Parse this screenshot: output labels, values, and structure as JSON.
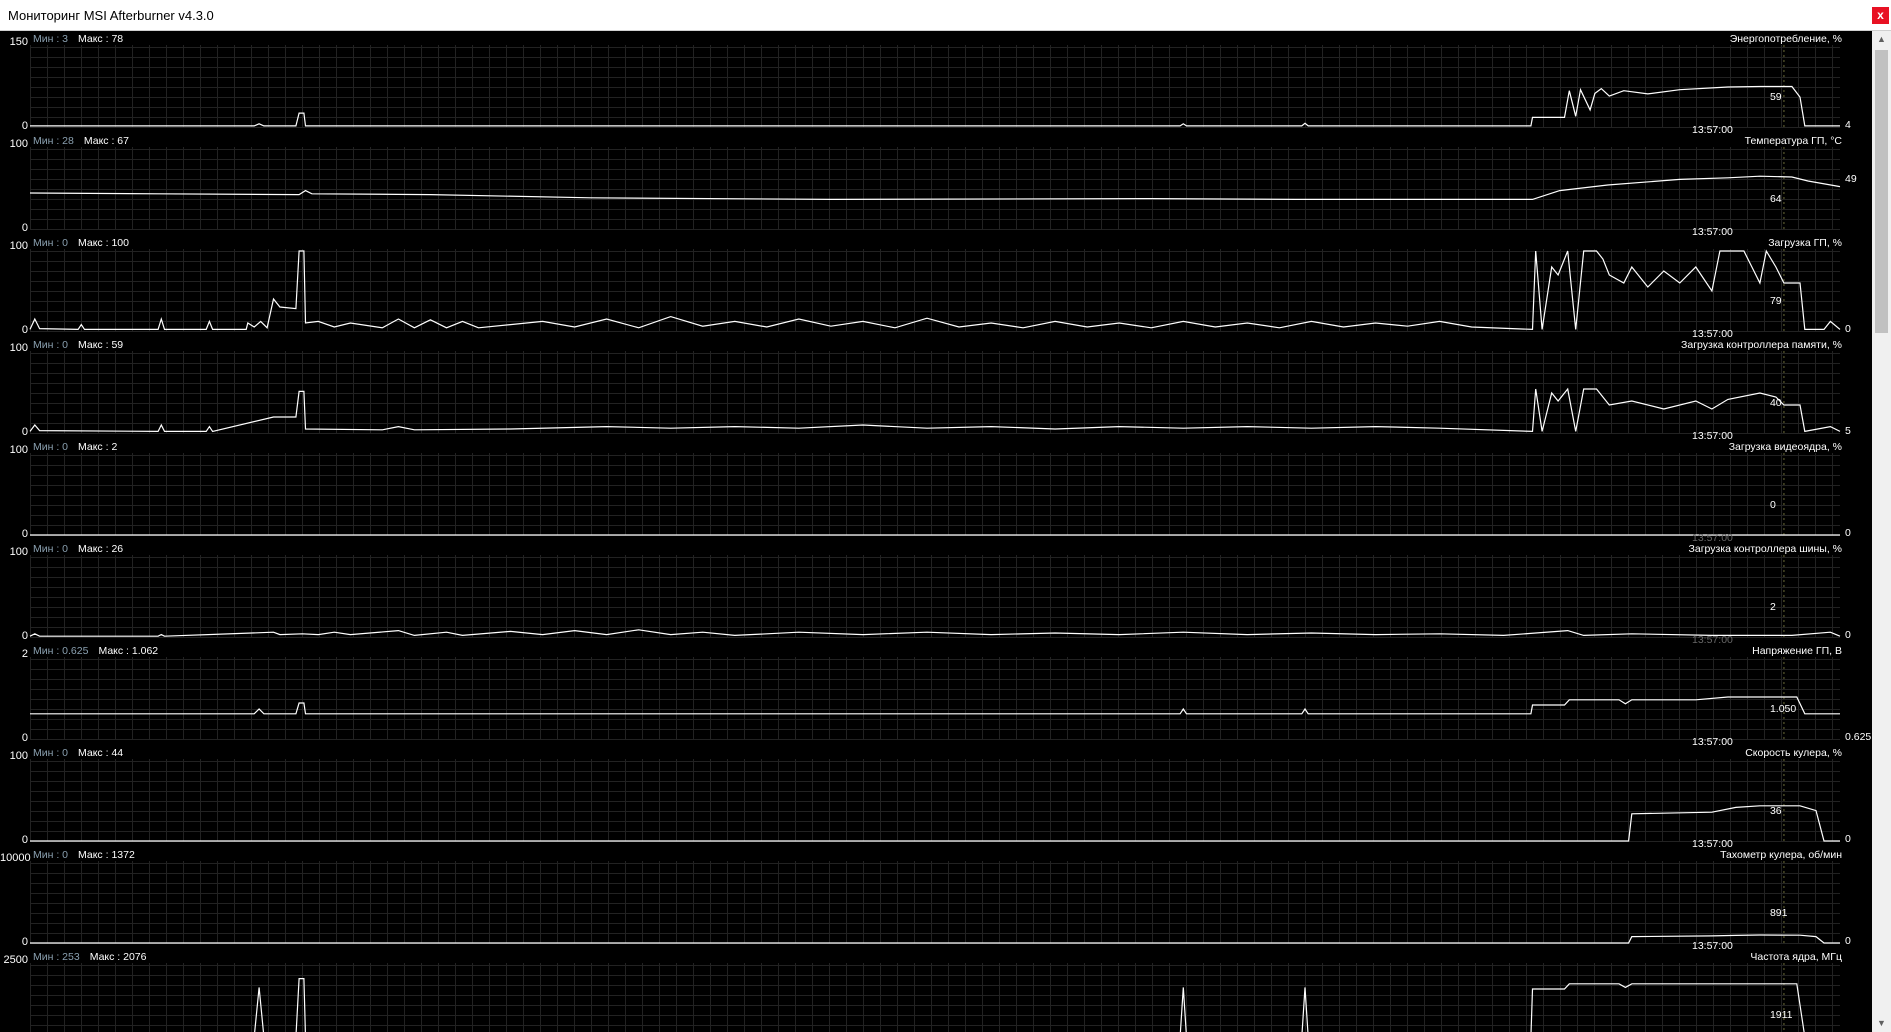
{
  "window": {
    "title": "Мониторинг MSI Afterburner v4.3.0",
    "close_label": "x"
  },
  "labels": {
    "min": "Мин : ",
    "max": "Макс : "
  },
  "colors": {
    "background": "#000000",
    "grid": "#222222",
    "line": "#ffffff",
    "close": "#e81123"
  },
  "scrollbar": {
    "position_fraction": 0.0,
    "visible_fraction": 0.28
  },
  "graphs": [
    {
      "name": "Энергопотребление, %",
      "ymax": "150",
      "ymin": "0",
      "min": "3",
      "max": "78",
      "current": "59",
      "right_value": "4",
      "timestamp": "13:57:00",
      "series": [
        [
          0,
          2
        ],
        [
          14,
          2
        ],
        [
          14.3,
          6
        ],
        [
          14.6,
          2
        ],
        [
          16.6,
          2
        ],
        [
          16.8,
          26
        ],
        [
          17.1,
          26
        ],
        [
          17.2,
          2
        ],
        [
          71.8,
          2
        ],
        [
          72,
          6
        ],
        [
          72.2,
          2
        ],
        [
          79.4,
          2
        ],
        [
          79.6,
          7
        ],
        [
          79.8,
          2
        ],
        [
          93.7,
          2
        ],
        [
          93.8,
          18
        ],
        [
          95.8,
          18
        ],
        [
          96.1,
          68
        ],
        [
          96.5,
          20
        ],
        [
          96.8,
          70
        ],
        [
          97.4,
          32
        ],
        [
          97.7,
          63
        ],
        [
          98.1,
          72
        ],
        [
          98.6,
          58
        ],
        [
          99.5,
          68
        ],
        [
          101,
          62
        ],
        [
          103,
          70
        ],
        [
          106,
          75
        ],
        [
          108,
          76
        ],
        [
          110,
          76
        ],
        [
          110.5,
          56
        ],
        [
          110.8,
          2
        ],
        [
          113,
          2
        ]
      ]
    },
    {
      "name": "Температура ГП, °C",
      "ymax": "100",
      "ymin": "0",
      "min": "28",
      "max": "67",
      "current": "64",
      "right_value": "49",
      "timestamp": "13:57:00",
      "series": [
        [
          0,
          45
        ],
        [
          8,
          44
        ],
        [
          16.8,
          43
        ],
        [
          17.2,
          48
        ],
        [
          17.6,
          44
        ],
        [
          25,
          43
        ],
        [
          35,
          39
        ],
        [
          50,
          37
        ],
        [
          70,
          38
        ],
        [
          79,
          37
        ],
        [
          93.8,
          37
        ],
        [
          95.5,
          48
        ],
        [
          98.5,
          55
        ],
        [
          103,
          62
        ],
        [
          106,
          64
        ],
        [
          108,
          66
        ],
        [
          110,
          65
        ],
        [
          111,
          60
        ],
        [
          113,
          53
        ]
      ]
    },
    {
      "name": "Загрузка ГП, %",
      "ymax": "100",
      "ymin": "0",
      "min": "0",
      "max": "100",
      "current": "79",
      "right_value": "0",
      "timestamp": "13:57:00",
      "series": [
        [
          0,
          2
        ],
        [
          0.3,
          15
        ],
        [
          0.6,
          3
        ],
        [
          3,
          2
        ],
        [
          3.2,
          8
        ],
        [
          3.4,
          2
        ],
        [
          8,
          2
        ],
        [
          8.2,
          15
        ],
        [
          8.4,
          2
        ],
        [
          11,
          2
        ],
        [
          11.2,
          12
        ],
        [
          11.4,
          2
        ],
        [
          13.5,
          2
        ],
        [
          13.6,
          10
        ],
        [
          14,
          5
        ],
        [
          14.4,
          12
        ],
        [
          14.8,
          4
        ],
        [
          15.2,
          40
        ],
        [
          15.6,
          30
        ],
        [
          16.6,
          28
        ],
        [
          16.8,
          100
        ],
        [
          17.1,
          100
        ],
        [
          17.2,
          10
        ],
        [
          18,
          12
        ],
        [
          19,
          5
        ],
        [
          20,
          10
        ],
        [
          22,
          4
        ],
        [
          23,
          15
        ],
        [
          24,
          4
        ],
        [
          25,
          14
        ],
        [
          26,
          4
        ],
        [
          27,
          12
        ],
        [
          28,
          4
        ],
        [
          30,
          8
        ],
        [
          32,
          12
        ],
        [
          34,
          5
        ],
        [
          36,
          15
        ],
        [
          38,
          4
        ],
        [
          40,
          18
        ],
        [
          42,
          6
        ],
        [
          44,
          12
        ],
        [
          46,
          5
        ],
        [
          48,
          15
        ],
        [
          50,
          6
        ],
        [
          52,
          12
        ],
        [
          54,
          4
        ],
        [
          56,
          16
        ],
        [
          58,
          5
        ],
        [
          60,
          10
        ],
        [
          62,
          4
        ],
        [
          64,
          12
        ],
        [
          66,
          5
        ],
        [
          68,
          10
        ],
        [
          70,
          4
        ],
        [
          72,
          12
        ],
        [
          74,
          5
        ],
        [
          76,
          10
        ],
        [
          78,
          4
        ],
        [
          80,
          12
        ],
        [
          82,
          5
        ],
        [
          84,
          10
        ],
        [
          86,
          6
        ],
        [
          88,
          12
        ],
        [
          90,
          5
        ],
        [
          93.8,
          2
        ],
        [
          94,
          100
        ],
        [
          94.4,
          2
        ],
        [
          95,
          80
        ],
        [
          95.4,
          70
        ],
        [
          96,
          100
        ],
        [
          96.5,
          2
        ],
        [
          97,
          100
        ],
        [
          97.8,
          100
        ],
        [
          98.2,
          90
        ],
        [
          98.6,
          70
        ],
        [
          99.5,
          60
        ],
        [
          100,
          80
        ],
        [
          101,
          55
        ],
        [
          102,
          75
        ],
        [
          103,
          60
        ],
        [
          104,
          80
        ],
        [
          105,
          50
        ],
        [
          105.5,
          100
        ],
        [
          107,
          100
        ],
        [
          107.5,
          80
        ],
        [
          108,
          60
        ],
        [
          108.4,
          100
        ],
        [
          109,
          80
        ],
        [
          109.5,
          60
        ],
        [
          110.5,
          60
        ],
        [
          110.8,
          2
        ],
        [
          112,
          2
        ],
        [
          112.4,
          12
        ],
        [
          113,
          2
        ]
      ]
    },
    {
      "name": "Загрузка контроллера памяти, %",
      "ymax": "100",
      "ymin": "0",
      "min": "0",
      "max": "59",
      "current": "40",
      "right_value": "5",
      "timestamp": "13:57:00",
      "series": [
        [
          0,
          2
        ],
        [
          0.3,
          10
        ],
        [
          0.6,
          3
        ],
        [
          8,
          2
        ],
        [
          8.2,
          10
        ],
        [
          8.4,
          2
        ],
        [
          11,
          2
        ],
        [
          11.2,
          8
        ],
        [
          11.4,
          2
        ],
        [
          15.2,
          20
        ],
        [
          16.6,
          20
        ],
        [
          16.8,
          52
        ],
        [
          17.1,
          52
        ],
        [
          17.2,
          5
        ],
        [
          22,
          4
        ],
        [
          23,
          8
        ],
        [
          24,
          4
        ],
        [
          30,
          5
        ],
        [
          36,
          8
        ],
        [
          40,
          6
        ],
        [
          44,
          8
        ],
        [
          48,
          6
        ],
        [
          52,
          10
        ],
        [
          56,
          6
        ],
        [
          60,
          8
        ],
        [
          64,
          5
        ],
        [
          68,
          8
        ],
        [
          72,
          6
        ],
        [
          76,
          8
        ],
        [
          80,
          6
        ],
        [
          84,
          8
        ],
        [
          88,
          6
        ],
        [
          93.8,
          2
        ],
        [
          94,
          55
        ],
        [
          94.4,
          2
        ],
        [
          95,
          50
        ],
        [
          95.4,
          40
        ],
        [
          96,
          55
        ],
        [
          96.5,
          2
        ],
        [
          97,
          55
        ],
        [
          97.8,
          55
        ],
        [
          98.6,
          35
        ],
        [
          100,
          40
        ],
        [
          102,
          30
        ],
        [
          104,
          40
        ],
        [
          105,
          30
        ],
        [
          106,
          42
        ],
        [
          108,
          50
        ],
        [
          109,
          45
        ],
        [
          109.5,
          35
        ],
        [
          110.5,
          35
        ],
        [
          110.8,
          2
        ],
        [
          112.4,
          8
        ],
        [
          113,
          2
        ]
      ]
    },
    {
      "name": "Загрузка видеоядра, %",
      "ymax": "100",
      "ymin": "0",
      "min": "0",
      "max": "2",
      "current": "0",
      "right_value": "0",
      "timestamp": "13:57:00",
      "series": [
        [
          0,
          0
        ],
        [
          113,
          0
        ]
      ]
    },
    {
      "name": "Загрузка контроллера шины, %",
      "ymax": "100",
      "ymin": "0",
      "min": "0",
      "max": "26",
      "current": "2",
      "right_value": "0",
      "timestamp": "13:57:00",
      "series": [
        [
          0,
          1
        ],
        [
          0.3,
          4
        ],
        [
          0.6,
          1
        ],
        [
          8,
          1
        ],
        [
          8.2,
          3
        ],
        [
          8.4,
          1
        ],
        [
          15.2,
          6
        ],
        [
          15.6,
          3
        ],
        [
          17,
          4
        ],
        [
          18,
          3
        ],
        [
          19,
          6
        ],
        [
          20,
          3
        ],
        [
          23,
          8
        ],
        [
          24,
          2
        ],
        [
          26,
          6
        ],
        [
          27,
          2
        ],
        [
          30,
          7
        ],
        [
          32,
          3
        ],
        [
          34,
          8
        ],
        [
          36,
          3
        ],
        [
          38,
          9
        ],
        [
          40,
          3
        ],
        [
          42,
          6
        ],
        [
          44,
          2
        ],
        [
          48,
          6
        ],
        [
          52,
          3
        ],
        [
          56,
          6
        ],
        [
          60,
          3
        ],
        [
          64,
          5
        ],
        [
          68,
          3
        ],
        [
          72,
          6
        ],
        [
          76,
          3
        ],
        [
          80,
          5
        ],
        [
          84,
          3
        ],
        [
          88,
          4
        ],
        [
          92,
          2
        ],
        [
          96,
          8
        ],
        [
          97,
          2
        ],
        [
          100,
          4
        ],
        [
          105,
          2
        ],
        [
          110,
          2
        ],
        [
          112.4,
          6
        ],
        [
          113,
          1
        ]
      ]
    },
    {
      "name": "Напряжение ГП, В",
      "ymax": "2",
      "ymin": "0",
      "min": "0.625",
      "max": "1.062",
      "current": "1.050",
      "right_value": "0.625",
      "timestamp": "13:57:00",
      "series": [
        [
          0,
          0.63
        ],
        [
          14,
          0.63
        ],
        [
          14.3,
          0.75
        ],
        [
          14.6,
          0.63
        ],
        [
          16.6,
          0.63
        ],
        [
          16.8,
          0.9
        ],
        [
          17.1,
          0.9
        ],
        [
          17.2,
          0.63
        ],
        [
          71.8,
          0.63
        ],
        [
          72,
          0.75
        ],
        [
          72.2,
          0.63
        ],
        [
          79.4,
          0.63
        ],
        [
          79.6,
          0.75
        ],
        [
          79.8,
          0.63
        ],
        [
          93.7,
          0.63
        ],
        [
          93.8,
          0.85
        ],
        [
          95.8,
          0.85
        ],
        [
          96.1,
          0.98
        ],
        [
          99.2,
          0.98
        ],
        [
          99.6,
          0.88
        ],
        [
          100,
          0.98
        ],
        [
          104,
          0.98
        ],
        [
          106,
          1.05
        ],
        [
          110.3,
          1.05
        ],
        [
          110.8,
          0.63
        ],
        [
          113,
          0.63
        ]
      ]
    },
    {
      "name": "Скорость кулера, %",
      "ymax": "100",
      "ymin": "0",
      "min": "0",
      "max": "44",
      "current": "36",
      "right_value": "0",
      "timestamp": "13:57:00",
      "series": [
        [
          0,
          0
        ],
        [
          99.8,
          0
        ],
        [
          100,
          34
        ],
        [
          105,
          36
        ],
        [
          106.5,
          42
        ],
        [
          108,
          44
        ],
        [
          110.5,
          44
        ],
        [
          111.5,
          38
        ],
        [
          112,
          0
        ],
        [
          113,
          0
        ]
      ]
    },
    {
      "name": "Тахометр кулера, об/мин",
      "ymax": "10000",
      "ymin": "0",
      "min": "0",
      "max": "1372",
      "current": "891",
      "right_value": "0",
      "timestamp": "13:57:00",
      "series": [
        [
          0,
          0
        ],
        [
          99.8,
          0
        ],
        [
          100,
          800
        ],
        [
          105,
          891
        ],
        [
          106.5,
          950
        ],
        [
          108,
          1000
        ],
        [
          110.5,
          980
        ],
        [
          111.5,
          800
        ],
        [
          112,
          0
        ],
        [
          113,
          0
        ]
      ]
    },
    {
      "name": "Частота ядра, МГц",
      "ymax": "2500",
      "ymin": "0",
      "min": "253",
      "max": "2076",
      "current": "1911",
      "right_value": "",
      "timestamp": "",
      "series": [
        [
          0,
          253
        ],
        [
          14,
          253
        ],
        [
          14.3,
          1800
        ],
        [
          14.6,
          253
        ],
        [
          16.6,
          253
        ],
        [
          16.8,
          2076
        ],
        [
          17.1,
          2076
        ],
        [
          17.2,
          253
        ],
        [
          71.8,
          253
        ],
        [
          72,
          1800
        ],
        [
          72.2,
          253
        ],
        [
          79.4,
          253
        ],
        [
          79.6,
          1800
        ],
        [
          79.8,
          253
        ],
        [
          93.7,
          253
        ],
        [
          93.8,
          1750
        ],
        [
          95.8,
          1750
        ],
        [
          96.1,
          1911
        ],
        [
          99.2,
          1911
        ],
        [
          99.6,
          1800
        ],
        [
          100,
          1911
        ],
        [
          106,
          1911
        ],
        [
          110.3,
          1911
        ],
        [
          110.8,
          253
        ],
        [
          113,
          253
        ]
      ]
    }
  ]
}
